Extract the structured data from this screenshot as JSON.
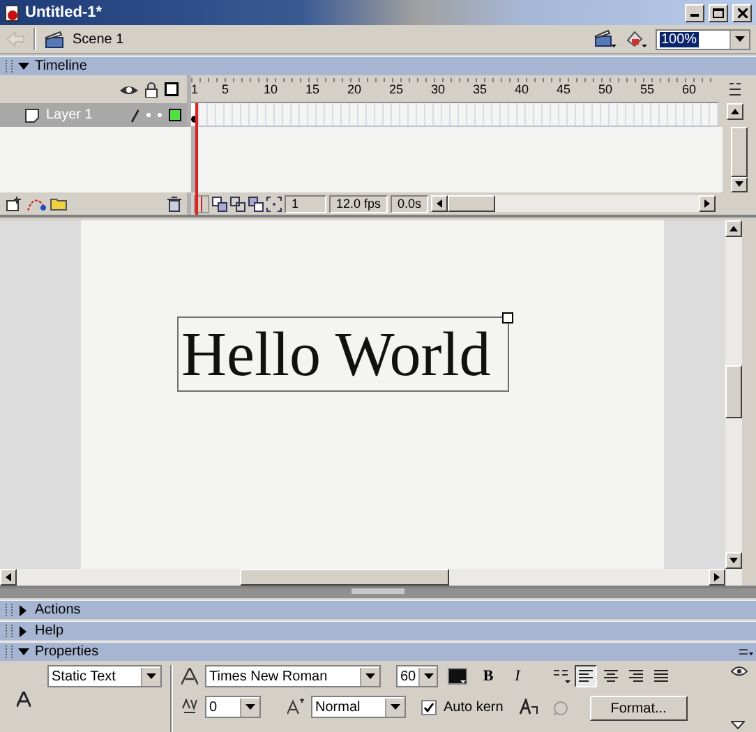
{
  "window": {
    "title": "Untitled-1*"
  },
  "scene_bar": {
    "scene": "Scene 1",
    "zoom": "100%"
  },
  "timeline": {
    "title": "Timeline",
    "expanded": true,
    "ruler": [
      "1",
      "5",
      "10",
      "15",
      "20",
      "25",
      "30",
      "35",
      "40",
      "45",
      "50",
      "55",
      "60"
    ],
    "layers": [
      {
        "name": "Layer 1",
        "selected": true,
        "keyframe": true
      }
    ],
    "current_frame": "1",
    "frame_rate": "12.0 fps",
    "elapsed": "0.0s"
  },
  "stage": {
    "text": "Hello World"
  },
  "panels": [
    {
      "title": "Actions",
      "expanded": false
    },
    {
      "title": "Help",
      "expanded": false
    },
    {
      "title": "Properties",
      "expanded": true
    }
  ],
  "properties": {
    "text_type": "Static Text",
    "font": "Times New Roman",
    "size": "60",
    "spacing": "0",
    "position": "Normal",
    "auto_kern": true,
    "auto_kern_label": "Auto kern",
    "bold_label": "B",
    "italic_label": "I",
    "bold": false,
    "italic": false,
    "align": [
      {
        "kind": "left",
        "selected": true
      },
      {
        "kind": "center",
        "selected": false
      },
      {
        "kind": "right",
        "selected": false
      },
      {
        "kind": "justify",
        "selected": false
      }
    ],
    "format_button": "Format..."
  }
}
